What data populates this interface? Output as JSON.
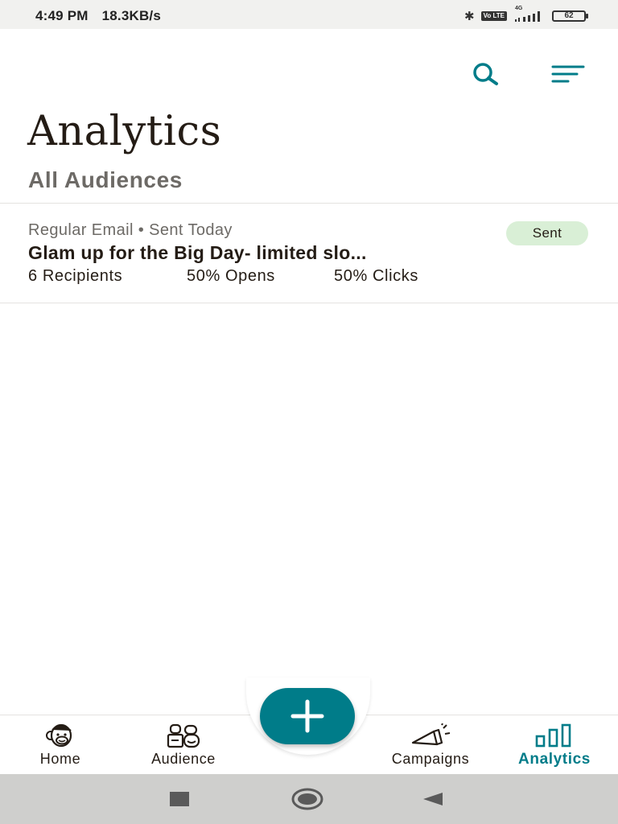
{
  "status_bar": {
    "time": "4:49 PM",
    "speed": "18.3KB/s",
    "volte": "Vo LTE",
    "network": "4G",
    "battery": "62"
  },
  "toolbar": {
    "search_icon": "search-icon",
    "filter_icon": "filter-lines-icon"
  },
  "page": {
    "title": "Analytics",
    "subtitle": "All Audiences"
  },
  "campaigns": [
    {
      "meta": "Regular Email • Sent Today",
      "title": "Glam up for the Big Day- limited slo...",
      "recipients": "6 Recipients",
      "opens": "50% Opens",
      "clicks": "50% Clicks",
      "status": "Sent"
    }
  ],
  "bottom_nav": {
    "items": [
      {
        "label": "Home",
        "icon": "monkey-icon"
      },
      {
        "label": "Audience",
        "icon": "audience-icon"
      },
      {
        "label": "Campaigns",
        "icon": "megaphone-icon"
      },
      {
        "label": "Analytics",
        "icon": "bar-chart-icon"
      }
    ],
    "active": "Analytics",
    "fab_icon": "plus-icon"
  },
  "colors": {
    "accent": "#007c89",
    "badge_bg": "#d9efd6",
    "text_dark": "#241c15",
    "text_muted": "#6d6a66"
  }
}
